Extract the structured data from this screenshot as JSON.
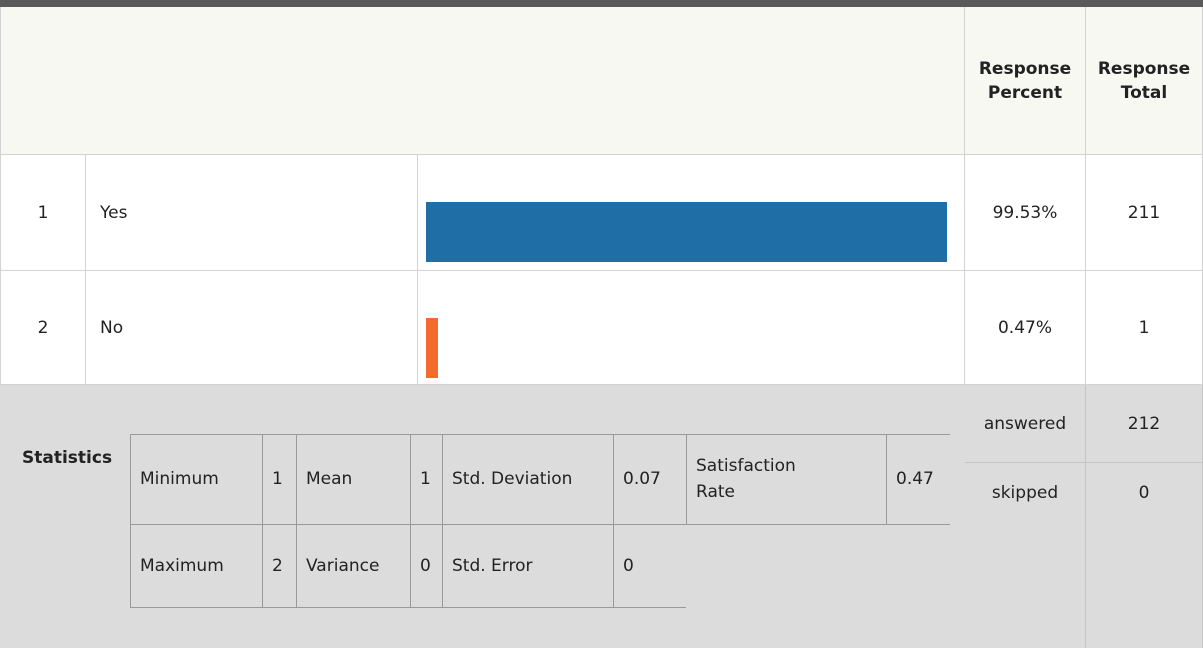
{
  "header": {
    "response_percent": "Response Percent",
    "response_total": "Response Total"
  },
  "rows": [
    {
      "num": "1",
      "label": "Yes",
      "percent": "99.53%",
      "total": "211",
      "fraction": 0.9953,
      "color": "#1f6fa6"
    },
    {
      "num": "2",
      "label": "No",
      "percent": "0.47%",
      "total": "1",
      "fraction": 0.0047,
      "color": "#f26b2d"
    }
  ],
  "summary": {
    "answered_label": "answered",
    "answered_value": "212",
    "skipped_label": "skipped",
    "skipped_value": "0"
  },
  "statistics": {
    "label": "Statistics",
    "minimum_label": "Minimum",
    "minimum_value": "1",
    "mean_label": "Mean",
    "mean_value": "1",
    "std_dev_label": "Std. Deviation",
    "std_dev_value": "0.07",
    "satisfaction_label": "Satisfaction Rate",
    "satisfaction_value": "0.47",
    "maximum_label": "Maximum",
    "maximum_value": "2",
    "variance_label": "Variance",
    "variance_value": "0",
    "std_error_label": "Std. Error",
    "std_error_value": "0"
  }
}
